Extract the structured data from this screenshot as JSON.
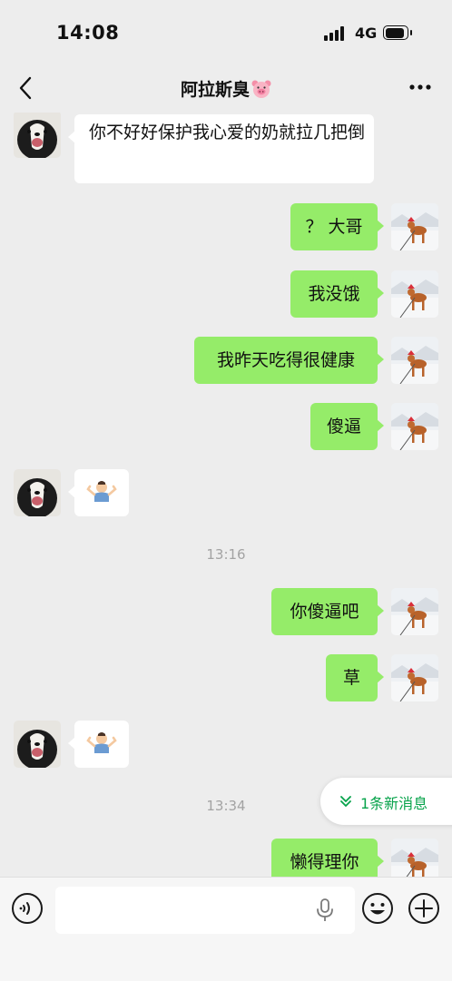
{
  "status_bar": {
    "time": "14:08",
    "network": "4G"
  },
  "header": {
    "title": "阿拉斯臭",
    "title_emoji": "pig-face-icon"
  },
  "messages": [
    {
      "side": "in",
      "type": "text",
      "text": "你不好好保护我心爱的奶就拉几把倒"
    },
    {
      "side": "out",
      "type": "text",
      "text": "？ 大哥"
    },
    {
      "side": "out",
      "type": "text",
      "text": "我没饿"
    },
    {
      "side": "out",
      "type": "text",
      "text": "我昨天吃得很健康"
    },
    {
      "side": "out",
      "type": "text",
      "text": "傻逼"
    },
    {
      "side": "in",
      "type": "emoji",
      "emoji": "person-shrugging-icon"
    },
    {
      "type": "time",
      "text": "13:16"
    },
    {
      "side": "out",
      "type": "text",
      "text": "你傻逼吧"
    },
    {
      "side": "out",
      "type": "text",
      "text": "草"
    },
    {
      "side": "in",
      "type": "emoji",
      "emoji": "person-shrugging-icon"
    },
    {
      "type": "time",
      "text": "13:34"
    },
    {
      "side": "out",
      "type": "text",
      "text": "懒得理你"
    }
  ],
  "new_messages": {
    "label": "1条新消息"
  },
  "input_bar": {
    "placeholder": ""
  },
  "colors": {
    "outgoing_bubble": "#95ec69",
    "incoming_bubble": "#ffffff",
    "background": "#ededed",
    "accent": "#07a34b"
  }
}
